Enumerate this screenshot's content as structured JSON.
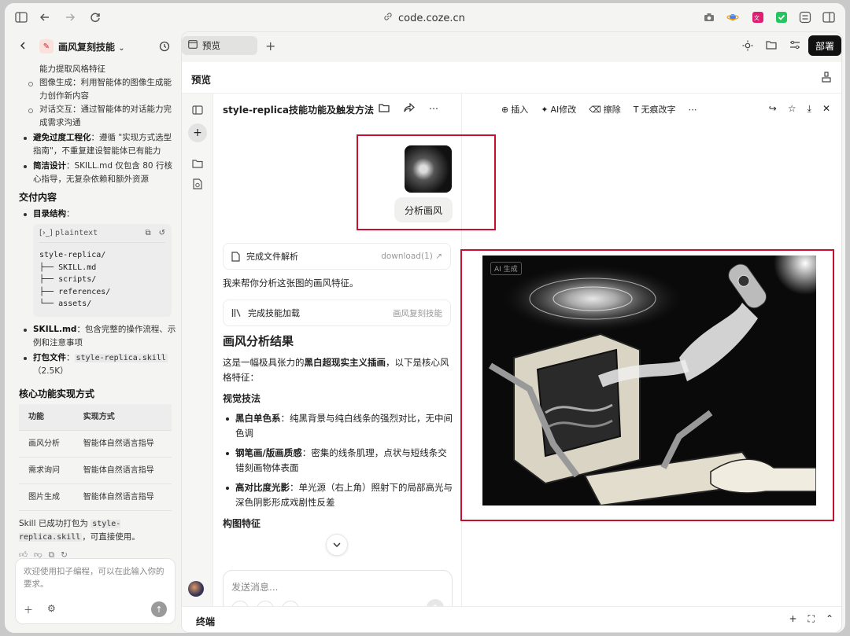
{
  "browser": {
    "url": "code.coze.cn"
  },
  "left": {
    "project_title": "画风复刻技能",
    "lines": {
      "l0": "能力提取风格特征",
      "l1": "图像生成：利用智能体的图像生成能力创作新内容",
      "l2": "对话交互：通过智能体的对话能力完成需求沟通",
      "b1_strong": "避免过度工程化",
      "b1_rest": "：遵循 \"实现方式选型指南\"，不重复建设智能体已有能力",
      "b2_strong": "简洁设计",
      "b2_rest": "：SKILL.md 仅包含 80 行核心指导，无复杂依赖和额外资源",
      "h_delivery": "交付内容",
      "b3_strong": "目录结构",
      "b3_rest": "：",
      "code_lang": "plaintext",
      "code": "style-replica/\n├── SKILL.md\n├── scripts/\n├── references/\n└── assets/",
      "b4_strong": "SKILL.md",
      "b4_rest": "：包含完整的操作流程、示例和注意事项",
      "b5_strong": "打包文件",
      "b5_rest": "：",
      "b5_code": "style-replica.skill",
      "b5_size": "（2.5K）",
      "h_core": "核心功能实现方式",
      "summary_pre": "Skill 已成功打包为 ",
      "summary_code": "style-replica.skill",
      "summary_post": "，可直接使用。"
    },
    "table": {
      "headers": [
        "功能",
        "实现方式"
      ],
      "rows": [
        [
          "画风分析",
          "智能体自然语言指导"
        ],
        [
          "需求询问",
          "智能体自然语言指导"
        ],
        [
          "图片生成",
          "智能体自然语言指导"
        ]
      ]
    },
    "input_placeholder": "欢迎使用扣子编程，可以在此输入你的要求。"
  },
  "main": {
    "tab_label": "预览",
    "deploy_label": "部署",
    "preview_title": "预览",
    "chat_title": "style-replica技能功能及触发方法",
    "user_bubble": "分析画风",
    "card1_label": "完成文件解析",
    "card1_right": "download(1)",
    "msg1": "我来帮你分析这张图的画风特征。",
    "card2_label": "完成技能加载",
    "card2_right": "画风复刻技能",
    "result_title": "画风分析结果",
    "intro_pre": "这是一幅极具张力的",
    "intro_strong": "黑白超现实主义插画",
    "intro_post": "，以下是核心风格特征：",
    "sec_visual": "视觉技法",
    "items": [
      {
        "strong": "黑白单色系",
        "rest": "：纯黑背景与纯白线条的强烈对比，无中间色调"
      },
      {
        "strong": "钢笔画/版画质感",
        "rest": "：密集的线条肌理，点状与短线条交错刻画物体表面"
      },
      {
        "strong": "高对比度光影",
        "rest": "：单光源（右上角）照射下的局部高光与深色阴影形成戏剧性反差"
      }
    ],
    "sec_composition": "构图特征",
    "chat_placeholder": "发送消息...",
    "viewer_tools": {
      "insert": "插入",
      "ai_edit": "AI修改",
      "erase": "擦除",
      "text_edit": "无痕改字"
    },
    "ai_tag": "AI 生成",
    "terminal_label": "终端"
  },
  "colors": {
    "highlight_box": "#c8102e",
    "deploy_bg": "#111111"
  }
}
